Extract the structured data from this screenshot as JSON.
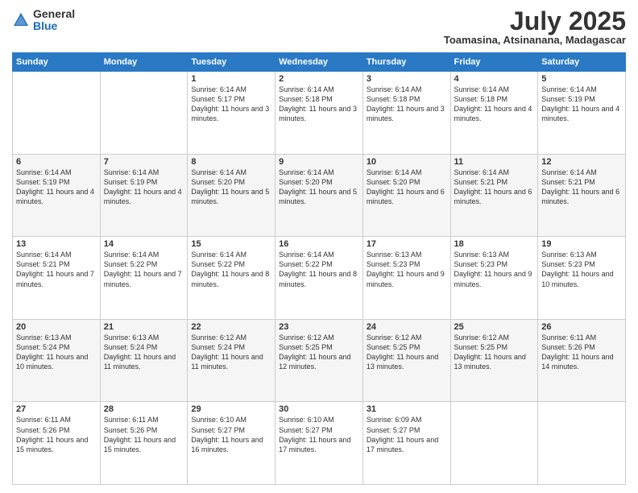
{
  "header": {
    "logo_general": "General",
    "logo_blue": "Blue",
    "title": "July 2025",
    "subtitle": "Toamasina, Atsinanana, Madagascar"
  },
  "weekdays": [
    "Sunday",
    "Monday",
    "Tuesday",
    "Wednesday",
    "Thursday",
    "Friday",
    "Saturday"
  ],
  "weeks": [
    [
      {
        "day": "",
        "text": ""
      },
      {
        "day": "",
        "text": ""
      },
      {
        "day": "1",
        "text": "Sunrise: 6:14 AM\nSunset: 5:17 PM\nDaylight: 11 hours and 3 minutes."
      },
      {
        "day": "2",
        "text": "Sunrise: 6:14 AM\nSunset: 5:18 PM\nDaylight: 11 hours and 3 minutes."
      },
      {
        "day": "3",
        "text": "Sunrise: 6:14 AM\nSunset: 5:18 PM\nDaylight: 11 hours and 3 minutes."
      },
      {
        "day": "4",
        "text": "Sunrise: 6:14 AM\nSunset: 5:18 PM\nDaylight: 11 hours and 4 minutes."
      },
      {
        "day": "5",
        "text": "Sunrise: 6:14 AM\nSunset: 5:19 PM\nDaylight: 11 hours and 4 minutes."
      }
    ],
    [
      {
        "day": "6",
        "text": "Sunrise: 6:14 AM\nSunset: 5:19 PM\nDaylight: 11 hours and 4 minutes."
      },
      {
        "day": "7",
        "text": "Sunrise: 6:14 AM\nSunset: 5:19 PM\nDaylight: 11 hours and 4 minutes."
      },
      {
        "day": "8",
        "text": "Sunrise: 6:14 AM\nSunset: 5:20 PM\nDaylight: 11 hours and 5 minutes."
      },
      {
        "day": "9",
        "text": "Sunrise: 6:14 AM\nSunset: 5:20 PM\nDaylight: 11 hours and 5 minutes."
      },
      {
        "day": "10",
        "text": "Sunrise: 6:14 AM\nSunset: 5:20 PM\nDaylight: 11 hours and 6 minutes."
      },
      {
        "day": "11",
        "text": "Sunrise: 6:14 AM\nSunset: 5:21 PM\nDaylight: 11 hours and 6 minutes."
      },
      {
        "day": "12",
        "text": "Sunrise: 6:14 AM\nSunset: 5:21 PM\nDaylight: 11 hours and 6 minutes."
      }
    ],
    [
      {
        "day": "13",
        "text": "Sunrise: 6:14 AM\nSunset: 5:21 PM\nDaylight: 11 hours and 7 minutes."
      },
      {
        "day": "14",
        "text": "Sunrise: 6:14 AM\nSunset: 5:22 PM\nDaylight: 11 hours and 7 minutes."
      },
      {
        "day": "15",
        "text": "Sunrise: 6:14 AM\nSunset: 5:22 PM\nDaylight: 11 hours and 8 minutes."
      },
      {
        "day": "16",
        "text": "Sunrise: 6:14 AM\nSunset: 5:22 PM\nDaylight: 11 hours and 8 minutes."
      },
      {
        "day": "17",
        "text": "Sunrise: 6:13 AM\nSunset: 5:23 PM\nDaylight: 11 hours and 9 minutes."
      },
      {
        "day": "18",
        "text": "Sunrise: 6:13 AM\nSunset: 5:23 PM\nDaylight: 11 hours and 9 minutes."
      },
      {
        "day": "19",
        "text": "Sunrise: 6:13 AM\nSunset: 5:23 PM\nDaylight: 11 hours and 10 minutes."
      }
    ],
    [
      {
        "day": "20",
        "text": "Sunrise: 6:13 AM\nSunset: 5:24 PM\nDaylight: 11 hours and 10 minutes."
      },
      {
        "day": "21",
        "text": "Sunrise: 6:13 AM\nSunset: 5:24 PM\nDaylight: 11 hours and 11 minutes."
      },
      {
        "day": "22",
        "text": "Sunrise: 6:12 AM\nSunset: 5:24 PM\nDaylight: 11 hours and 11 minutes."
      },
      {
        "day": "23",
        "text": "Sunrise: 6:12 AM\nSunset: 5:25 PM\nDaylight: 11 hours and 12 minutes."
      },
      {
        "day": "24",
        "text": "Sunrise: 6:12 AM\nSunset: 5:25 PM\nDaylight: 11 hours and 13 minutes."
      },
      {
        "day": "25",
        "text": "Sunrise: 6:12 AM\nSunset: 5:25 PM\nDaylight: 11 hours and 13 minutes."
      },
      {
        "day": "26",
        "text": "Sunrise: 6:11 AM\nSunset: 5:26 PM\nDaylight: 11 hours and 14 minutes."
      }
    ],
    [
      {
        "day": "27",
        "text": "Sunrise: 6:11 AM\nSunset: 5:26 PM\nDaylight: 11 hours and 15 minutes."
      },
      {
        "day": "28",
        "text": "Sunrise: 6:11 AM\nSunset: 5:26 PM\nDaylight: 11 hours and 15 minutes."
      },
      {
        "day": "29",
        "text": "Sunrise: 6:10 AM\nSunset: 5:27 PM\nDaylight: 11 hours and 16 minutes."
      },
      {
        "day": "30",
        "text": "Sunrise: 6:10 AM\nSunset: 5:27 PM\nDaylight: 11 hours and 17 minutes."
      },
      {
        "day": "31",
        "text": "Sunrise: 6:09 AM\nSunset: 5:27 PM\nDaylight: 11 hours and 17 minutes."
      },
      {
        "day": "",
        "text": ""
      },
      {
        "day": "",
        "text": ""
      }
    ]
  ]
}
